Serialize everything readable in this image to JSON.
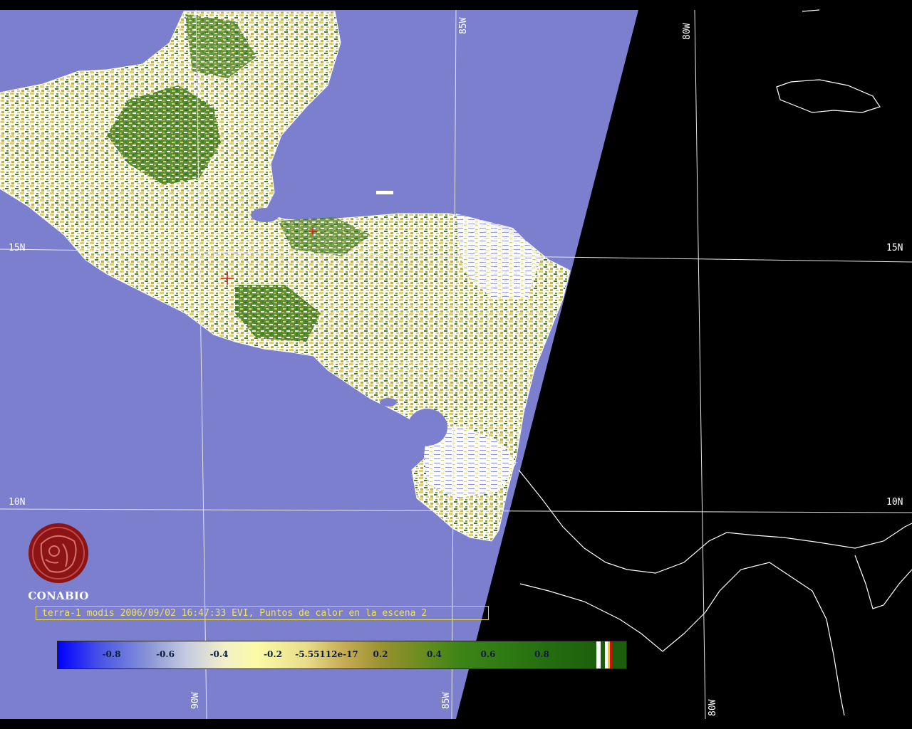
{
  "map": {
    "ocean_color": "#7b7fcd",
    "night_color": "#000000",
    "coast_color": "#ffffff",
    "graticule_color": "#ffffff",
    "land_low_color": "#ffffff",
    "land_mid_color": "#d8cf78",
    "land_high_color": "#3f7f1a",
    "hotspot_color": "#d81a1a"
  },
  "graticule_labels": {
    "lat_15_left": "15N",
    "lat_15_right": "15N",
    "lat_10_left": "10N",
    "lat_10_right": "10N",
    "lon_85_top": "85W",
    "lon_80_top": "80W",
    "lon_90_bottom": "90W",
    "lon_85_bottom": "85W",
    "lon_80_bottom": "80W"
  },
  "logo": {
    "name": "CONABIO",
    "color": "#8c1414"
  },
  "caption": "terra-1 modis 2006/09/02 16:47:33 EVI, Puntos de calor en la escena 2",
  "colorbar": {
    "ticks": [
      "-0.8",
      "-0.6",
      "-0.4",
      "-0.2",
      "-5.55112e-17",
      "0.2",
      "0.4",
      "0.6",
      "0.8"
    ],
    "tick_values": [
      -0.8,
      -0.6,
      -0.4,
      -0.2,
      0.0,
      0.2,
      0.4,
      0.6,
      0.8
    ],
    "range": [
      -1.0,
      1.0
    ],
    "extra_stripes": [
      "#ffffff",
      "#1c5e0c",
      "#ffffff",
      "#e8d000",
      "#d01010"
    ]
  }
}
